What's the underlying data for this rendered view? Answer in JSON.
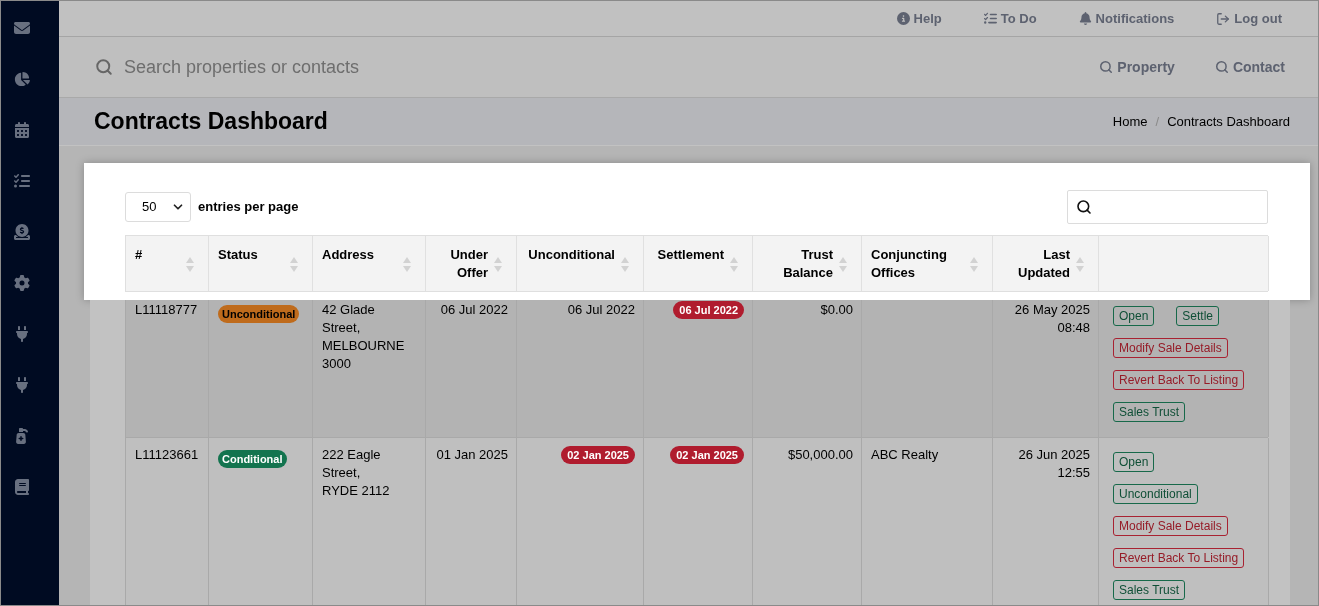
{
  "top_nav": [
    {
      "label": "Help"
    },
    {
      "label": "To Do"
    },
    {
      "label": "Notifications"
    },
    {
      "label": "Log out"
    }
  ],
  "search": {
    "placeholder": "Search properties or contacts",
    "scopes": [
      {
        "label": "Property"
      },
      {
        "label": "Contact"
      }
    ]
  },
  "page_header": {
    "title": "Contracts Dashboard",
    "breadcrumb": [
      {
        "label": "Home"
      },
      {
        "label": "Contracts Dashboard"
      }
    ],
    "breadcrumb_separator": "/"
  },
  "entries": {
    "value": "50",
    "label": "entries per page"
  },
  "table": {
    "columns": [
      {
        "label": "#"
      },
      {
        "label": "Status"
      },
      {
        "label": "Address"
      },
      {
        "label": "Under Offer"
      },
      {
        "label": "Unconditional"
      },
      {
        "label": "Settlement"
      },
      {
        "label": "Trust Balance"
      },
      {
        "label": "Conjuncting Offices"
      },
      {
        "label": "Last Updated"
      }
    ],
    "rows": [
      {
        "id": "L11118777",
        "status": {
          "label": "Unconditional",
          "kind": "warning"
        },
        "address": [
          "42 Glade Street,",
          "MELBOURNE 3000"
        ],
        "under_offer": "06 Jul 2022",
        "unconditional": {
          "date": "06 Jul 2022",
          "highlight": false
        },
        "settlement": {
          "date": "06 Jul 2022",
          "highlight": true
        },
        "trust_balance": "$0.00",
        "last_updated": "26 May 2025 08:48",
        "actions": [
          [
            {
              "label": "Open",
              "kind": "success"
            },
            {
              "label": "Settle",
              "kind": "success"
            }
          ],
          [
            {
              "label": "Modify Sale Details",
              "kind": "danger"
            }
          ],
          [
            {
              "label": "Revert Back To Listing",
              "kind": "danger"
            }
          ],
          [
            {
              "label": "Sales Trust",
              "kind": "success"
            }
          ]
        ]
      },
      {
        "id": "L11123661",
        "status": {
          "label": "Conditional",
          "kind": "success"
        },
        "address": [
          "222 Eagle Street,",
          "RYDE 2112"
        ],
        "under_offer": "01 Jan 2025",
        "unconditional": {
          "date": "02 Jan 2025",
          "highlight": true
        },
        "settlement": {
          "date": "02 Jan 2025",
          "highlight": true
        },
        "trust_balance": "$50,000.00",
        "conjuncting_offices": "ABC Realty",
        "last_updated": "26 Jun 2025 12:55",
        "actions": [
          [
            {
              "label": "Open",
              "kind": "success"
            }
          ],
          [
            {
              "label": "Unconditional",
              "kind": "success"
            }
          ],
          [
            {
              "label": "Modify Sale Details",
              "kind": "danger"
            }
          ],
          [
            {
              "label": "Revert Back To Listing",
              "kind": "danger"
            }
          ],
          [
            {
              "label": "Sales Trust",
              "kind": "success"
            }
          ]
        ]
      }
    ]
  }
}
